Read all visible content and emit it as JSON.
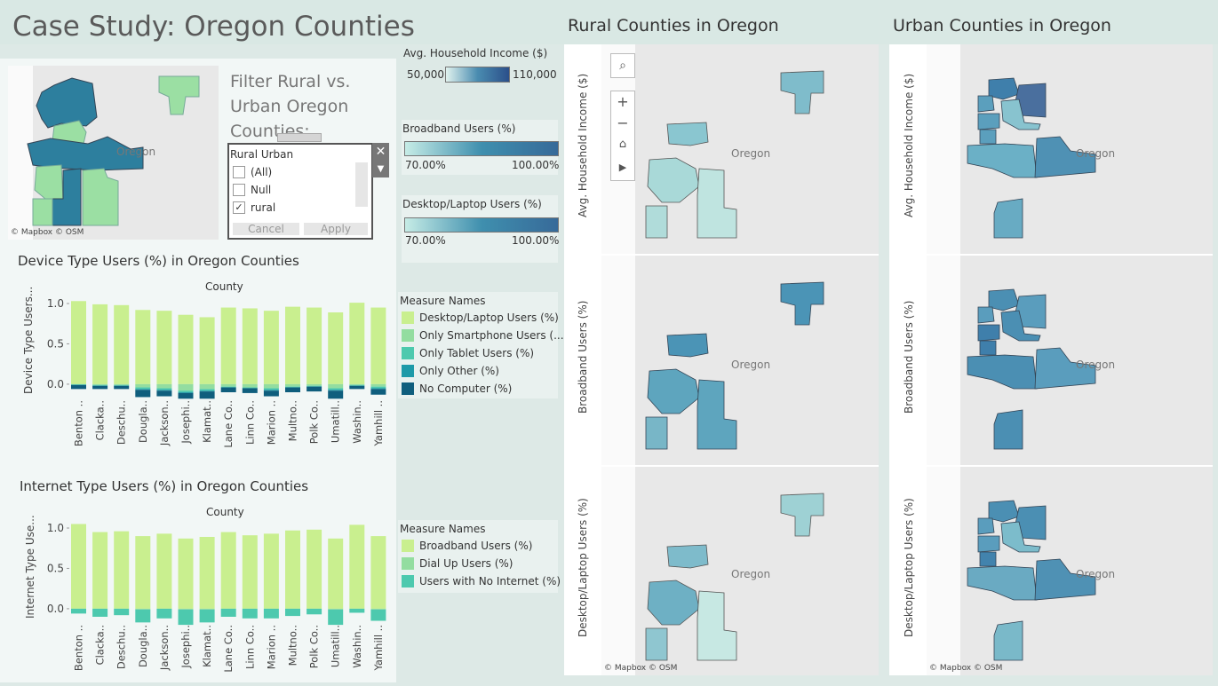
{
  "title": "Case Study: Oregon Counties",
  "filter": {
    "heading_lines": [
      "Filter Rural vs.",
      "Urban Oregon",
      "Counties:"
    ],
    "field": "Rural Urban",
    "options": [
      {
        "label": "(All)",
        "checked": false
      },
      {
        "label": "Null",
        "checked": false
      },
      {
        "label": "rural",
        "checked": true
      }
    ],
    "cancel_label": "Cancel",
    "apply_label": "Apply"
  },
  "map_attribution": "© Mapbox © OSM",
  "oregon_label": "Oregon",
  "income_legend": {
    "title": "Avg. Household Income ($)",
    "min": "50,000",
    "max": "110,000"
  },
  "broadband_legend": {
    "title": "Broadband Users (%)",
    "min": "70.00%",
    "max": "100.00%"
  },
  "desktop_legend": {
    "title": "Desktop/Laptop Users (%)",
    "min": "70.00%",
    "max": "100.00%"
  },
  "device_legend": {
    "title": "Measure Names",
    "items": [
      {
        "label": "Desktop/Laptop Users (%)",
        "color": "#c9ef8f"
      },
      {
        "label": "Only Smartphone Users (...",
        "color": "#93dda0"
      },
      {
        "label": "Only Tablet Users (%)",
        "color": "#4dc9ae"
      },
      {
        "label": "Only Other (%)",
        "color": "#1e9aa8"
      },
      {
        "label": "No Computer (%)",
        "color": "#0f5e7d"
      }
    ]
  },
  "internet_legend": {
    "title": "Measure Names",
    "items": [
      {
        "label": "Broadband Users (%)",
        "color": "#c9ef8f"
      },
      {
        "label": "Dial Up Users (%)",
        "color": "#93dda0"
      },
      {
        "label": "Users with No Internet (%)",
        "color": "#4dc9ae"
      }
    ]
  },
  "rural_title": "Rural Counties in Oregon",
  "urban_title": "Urban Counties in Oregon",
  "map_row_labels": [
    "Avg. Household Income ($)",
    "Broadband Users (%)",
    "Desktop/Laptop Users (%)"
  ],
  "chart_data": [
    {
      "type": "bar",
      "title": "Device Type Users (%) in Oregon Counties",
      "xlabel": "County",
      "ylabel": "Device Type Users...",
      "ylim": [
        -0.1,
        1.0
      ],
      "yticks": [
        "1.0",
        "0.5",
        "0.0"
      ],
      "categories": [
        "Benton ..",
        "Clacka..",
        "Deschu..",
        "Dougla..",
        "Jackson..",
        "Josephi..",
        "Klamat..",
        "Lane Co..",
        "Linn Co..",
        "Marion ..",
        "Multno..",
        "Polk Co..",
        "Umatill..",
        "Washin..",
        "Yamhill .."
      ],
      "series": [
        {
          "name": "Desktop/Laptop Users (%)",
          "values": [
            1.03,
            0.99,
            0.98,
            0.92,
            0.91,
            0.86,
            0.83,
            0.95,
            0.94,
            0.91,
            0.96,
            0.95,
            0.89,
            1.01,
            0.95
          ]
        },
        {
          "name": "Only Smartphone Users (...",
          "values": [
            0.0,
            0.01,
            0.01,
            0.04,
            0.05,
            0.08,
            0.06,
            0.03,
            0.04,
            0.05,
            0.03,
            0.02,
            0.05,
            0.01,
            0.03
          ]
        },
        {
          "name": "Only Tablet Users (%)",
          "values": [
            0.01,
            0.01,
            0.01,
            0.02,
            0.02,
            0.02,
            0.02,
            0.01,
            0.01,
            0.02,
            0.01,
            0.01,
            0.02,
            0.01,
            0.02
          ]
        },
        {
          "name": "Only Other (%)",
          "values": [
            0.0,
            0.0,
            0.0,
            0.01,
            0.01,
            0.01,
            0.01,
            0.0,
            0.0,
            0.01,
            0.0,
            0.0,
            0.01,
            0.0,
            0.01
          ]
        },
        {
          "name": "No Computer (%)",
          "values": [
            0.05,
            0.04,
            0.04,
            0.09,
            0.07,
            0.07,
            0.09,
            0.06,
            0.06,
            0.07,
            0.06,
            0.06,
            0.1,
            0.04,
            0.07
          ]
        }
      ]
    },
    {
      "type": "bar",
      "title": "Internet Type Users (%) in Oregon Counties",
      "xlabel": "County",
      "ylabel": "Internet Type Use...",
      "ylim": [
        -0.1,
        1.0
      ],
      "yticks": [
        "1.0",
        "0.5",
        "0.0"
      ],
      "categories": [
        "Benton ..",
        "Clacka..",
        "Deschu..",
        "Dougla..",
        "Jackson..",
        "Josephi..",
        "Klamat..",
        "Lane Co..",
        "Linn Co..",
        "Marion ..",
        "Multno..",
        "Polk Co..",
        "Umatill..",
        "Washin..",
        "Yamhill .."
      ],
      "series": [
        {
          "name": "Broadband Users (%)",
          "values": [
            1.05,
            0.95,
            0.96,
            0.9,
            0.93,
            0.87,
            0.89,
            0.95,
            0.91,
            0.93,
            0.97,
            0.98,
            0.87,
            1.04,
            0.9
          ]
        },
        {
          "name": "Dial Up Users (%)",
          "values": [
            0.0,
            0.0,
            0.0,
            0.01,
            0.0,
            0.01,
            0.01,
            0.0,
            0.0,
            0.0,
            0.0,
            0.0,
            0.01,
            0.0,
            0.01
          ]
        },
        {
          "name": "Users with No Internet (%)",
          "values": [
            0.06,
            0.1,
            0.08,
            0.16,
            0.12,
            0.19,
            0.16,
            0.1,
            0.12,
            0.12,
            0.09,
            0.07,
            0.19,
            0.05,
            0.14
          ]
        }
      ]
    }
  ]
}
